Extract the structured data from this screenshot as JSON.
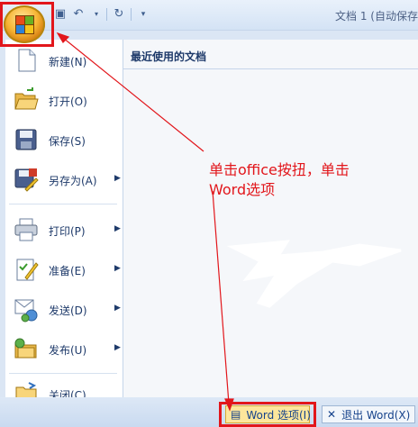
{
  "titlebar": {
    "document_title": "文档 1 (自动保存"
  },
  "quick_access": {
    "icons": [
      "save-icon",
      "undo-icon",
      "redo-icon",
      "customize-dropdown-icon"
    ]
  },
  "menu": {
    "items": [
      {
        "label": "新建(N)",
        "icon": "new-document-icon",
        "submenu": false
      },
      {
        "label": "打开(O)",
        "icon": "open-folder-icon",
        "submenu": false
      },
      {
        "label": "保存(S)",
        "icon": "save-icon",
        "submenu": false
      },
      {
        "label": "另存为(A)",
        "icon": "save-as-icon",
        "submenu": true
      },
      {
        "label": "打印(P)",
        "icon": "printer-icon",
        "submenu": true
      },
      {
        "label": "准备(E)",
        "icon": "prepare-icon",
        "submenu": true
      },
      {
        "label": "发送(D)",
        "icon": "send-icon",
        "submenu": true
      },
      {
        "label": "发布(U)",
        "icon": "publish-icon",
        "submenu": true
      },
      {
        "label": "关闭(C)",
        "icon": "close-folder-icon",
        "submenu": false
      }
    ],
    "recent_documents_title": "最近使用的文档"
  },
  "bottom": {
    "word_options_label": "Word 选项(I)",
    "exit_word_label": "退出 Word(X)"
  },
  "annotation": {
    "line1": "单击office按扭，单击",
    "line2": "Word选项"
  },
  "colors": {
    "annotation": "#e2161b",
    "menu_text": "#1e3a6a",
    "highlight": "#fde69c"
  }
}
